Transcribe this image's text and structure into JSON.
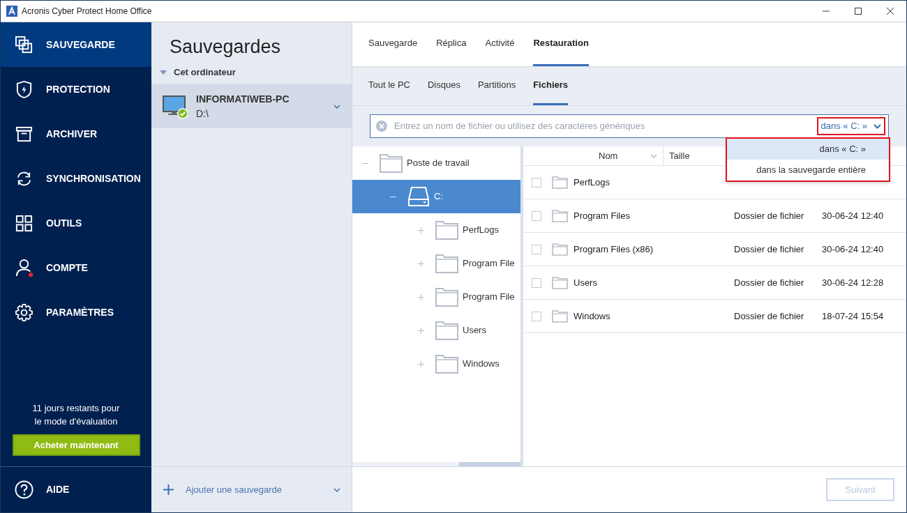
{
  "window": {
    "title": "Acronis Cyber Protect Home Office"
  },
  "nav": {
    "items": [
      {
        "label": "SAUVEGARDE",
        "selected": true,
        "notification": false
      },
      {
        "label": "PROTECTION",
        "selected": false,
        "notification": false
      },
      {
        "label": "ARCHIVER",
        "selected": false,
        "notification": false
      },
      {
        "label": "SYNCHRONISATION",
        "selected": false,
        "notification": false
      },
      {
        "label": "OUTILS",
        "selected": false,
        "notification": false
      },
      {
        "label": "COMPTE",
        "selected": false,
        "notification": true
      },
      {
        "label": "PARAMÈTRES",
        "selected": false,
        "notification": false
      }
    ],
    "trial_text": "11 jours restants pour\nle mode d'évaluation",
    "buy_button": "Acheter maintenant",
    "help": "AIDE"
  },
  "backups": {
    "title": "Sauvegardes",
    "group": {
      "label": "Cet ordinateur",
      "expanded": true
    },
    "items": [
      {
        "name": "INFORMATIWEB-PC",
        "subtitle": "D:\\",
        "selected": true
      }
    ],
    "add_button": "Ajouter une sauvegarde"
  },
  "tabs": [
    {
      "label": "Sauvegarde",
      "selected": false
    },
    {
      "label": "Réplica",
      "selected": false
    },
    {
      "label": "Activité",
      "selected": false
    },
    {
      "label": "Restauration",
      "selected": true
    }
  ],
  "subtabs": [
    {
      "label": "Tout le PC",
      "selected": false
    },
    {
      "label": "Disques",
      "selected": false
    },
    {
      "label": "Partitions",
      "selected": false
    },
    {
      "label": "Fichiers",
      "selected": true
    }
  ],
  "search": {
    "placeholder": "Entrez un nom de fichier ou utilisez des caractères génériques",
    "scope": "dans « C: »",
    "scope_menu": [
      {
        "label": "dans « C: »",
        "selected": true
      },
      {
        "label": "dans la sauvegarde entière",
        "selected": false
      }
    ]
  },
  "tree": [
    {
      "label": "Poste de travail",
      "kind": "computer",
      "expanded": true,
      "selected": false,
      "children": [
        {
          "label": "C:",
          "kind": "drive",
          "expanded": true,
          "selected": true,
          "children": [
            {
              "label": "PerfLogs",
              "kind": "folder",
              "expanded": false,
              "selected": false
            },
            {
              "label": "Program File",
              "kind": "folder",
              "expanded": false,
              "selected": false
            },
            {
              "label": "Program File",
              "kind": "folder",
              "expanded": false,
              "selected": false
            },
            {
              "label": "Users",
              "kind": "folder",
              "expanded": false,
              "selected": false
            },
            {
              "label": "Windows",
              "kind": "folder",
              "expanded": false,
              "selected": false
            }
          ]
        }
      ]
    }
  ],
  "table": {
    "columns": [
      "Nom",
      "Taille"
    ],
    "rows": [
      {
        "name": "PerfLogs",
        "checked": false
      },
      {
        "name": "Program Files",
        "checked": false,
        "type": "Dossier de fichier",
        "date": "30-06-24 12:40"
      },
      {
        "name": "Program Files (x86)",
        "checked": false,
        "type": "Dossier de fichier",
        "date": "30-06-24 12:40"
      },
      {
        "name": "Users",
        "checked": false,
        "type": "Dossier de fichier",
        "date": "30-06-24 12:28"
      },
      {
        "name": "Windows",
        "checked": false,
        "type": "Dossier de fichier",
        "date": "18-07-24 15:54"
      }
    ]
  },
  "next_button": {
    "label": "Suivant",
    "disabled": true
  }
}
